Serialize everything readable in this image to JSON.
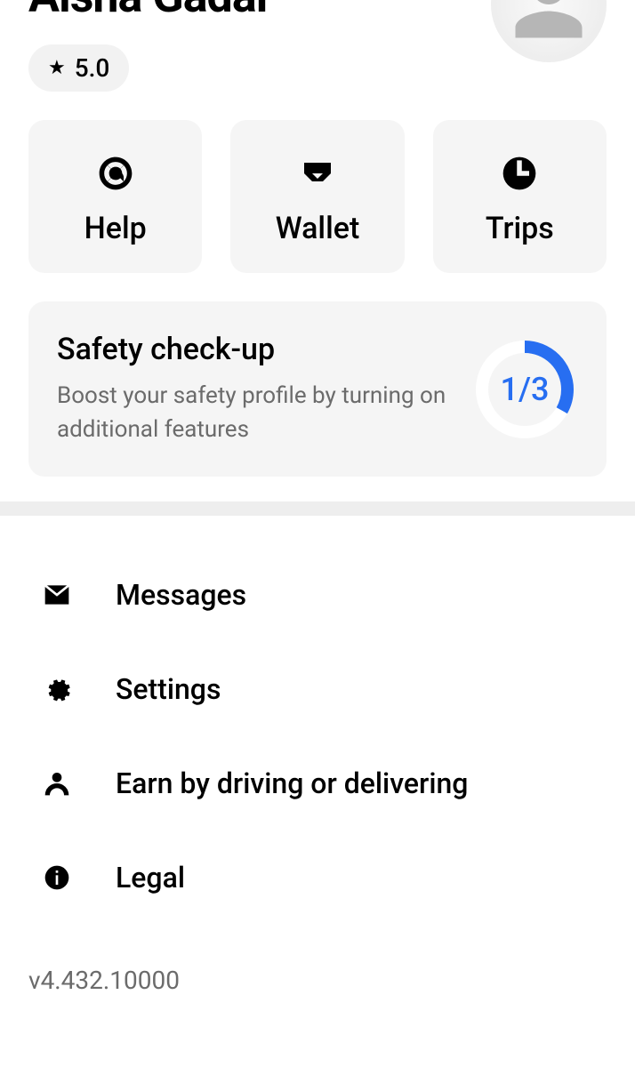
{
  "user": {
    "name": "Aisha Gadal",
    "rating": "5.0"
  },
  "tiles": {
    "help": "Help",
    "wallet": "Wallet",
    "trips": "Trips"
  },
  "safety": {
    "title": "Safety check-up",
    "subtitle": "Boost your safety profile by turning on additional features",
    "progress_label": "1/3",
    "progress_completed": 1,
    "progress_total": 3
  },
  "menu": {
    "messages": "Messages",
    "settings": "Settings",
    "earn": "Earn by driving or delivering",
    "legal": "Legal"
  },
  "version": "v4.432.10000",
  "colors": {
    "accent_blue": "#276ef1"
  }
}
